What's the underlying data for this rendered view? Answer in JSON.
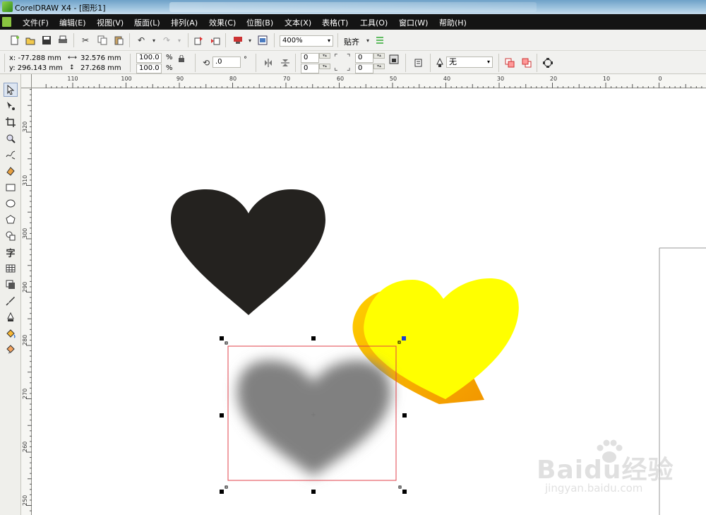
{
  "window": {
    "title": "CorelDRAW X4 - [图形1]"
  },
  "menu": [
    "文件(F)",
    "编辑(E)",
    "视图(V)",
    "版面(L)",
    "排列(A)",
    "效果(C)",
    "位图(B)",
    "文本(X)",
    "表格(T)",
    "工具(O)",
    "窗口(W)",
    "帮助(H)"
  ],
  "toolbar": {
    "zoom": "400%",
    "snap": "贴齐"
  },
  "property_bar": {
    "x": "x: -77.288 mm",
    "y": "y: 296.143 mm",
    "width": "32.576 mm",
    "height": "27.268 mm",
    "scale_x": "100.0",
    "scale_y": "100.0",
    "percent": "%",
    "rotation": ".0",
    "degree": "°",
    "pos1": "0",
    "pos2": "0",
    "pos3": "0",
    "pos4": "0",
    "outline": "无"
  },
  "ruler": {
    "h_labels": [
      "110",
      "100",
      "90",
      "80",
      "70",
      "60",
      "50",
      "40",
      "30",
      "20",
      "10",
      "0"
    ],
    "v_labels": [
      "320",
      "310",
      "300",
      "290",
      "280",
      "270",
      "260",
      "250"
    ]
  },
  "toolbox_icons": [
    "pick-tool-icon",
    "shape-tool-icon",
    "crop-tool-icon",
    "zoom-tool-icon",
    "freehand-tool-icon",
    "smart-fill-icon",
    "rectangle-tool-icon",
    "ellipse-tool-icon",
    "polygon-tool-icon",
    "basic-shapes-icon",
    "text-tool-icon",
    "table-tool-icon",
    "interactive-tool-icon",
    "eyedropper-tool-icon",
    "outline-tool-icon",
    "fill-tool-icon",
    "interactive-fill-icon"
  ],
  "colors": {
    "black_heart": "#24221f",
    "yellow_heart": "#ffff00",
    "yellow_side": "#f5a800",
    "gray_heart": "#808080",
    "selection_box": "#e0404a",
    "menubar": "#141414"
  },
  "watermark": {
    "text": "Baidu经验",
    "sub": "jingyan.baidu.com"
  }
}
